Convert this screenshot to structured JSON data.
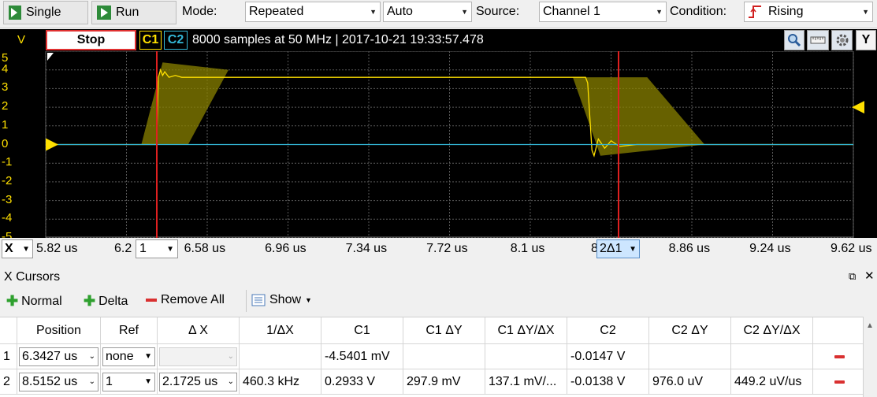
{
  "toolbar": {
    "single_label": "Single",
    "run_label": "Run",
    "mode_label": "Mode:",
    "mode_value": "Repeated",
    "auto_value": "Auto",
    "source_label": "Source:",
    "source_value": "Channel 1",
    "condition_label": "Condition:",
    "condition_value": "Rising"
  },
  "scope": {
    "y_unit": "V",
    "stop_label": "Stop",
    "c1_label": "C1",
    "c2_label": "C2",
    "status": "8000 samples at 50 MHz | 2017-10-21 19:33:57.478",
    "y_button": "Y",
    "x_button": "X",
    "colors": {
      "c1": "#ffe000",
      "c2": "#33b8d8",
      "cursor": "#e02020",
      "accent": "#ffe000"
    }
  },
  "chart_data": {
    "type": "line",
    "title": "",
    "xlabel": "",
    "ylabel": "V",
    "xlim": [
      5.82,
      9.62
    ],
    "ylim": [
      -5,
      5
    ],
    "y_ticks": [
      "5",
      "4",
      "3",
      "2",
      "1",
      "0",
      "-1",
      "-2",
      "-3",
      "-4",
      "-5"
    ],
    "x_ticks": [
      "5.82 us",
      "6.2",
      "6.58 us",
      "6.96 us",
      "7.34 us",
      "7.72 us",
      "8.1 us",
      "8",
      "8.86 us",
      "9.24 us",
      "9.62 us"
    ],
    "x_tick_values": [
      5.82,
      6.2,
      6.58,
      6.96,
      7.34,
      7.72,
      8.1,
      8.48,
      8.86,
      9.24,
      9.62
    ],
    "series": [
      {
        "x": [
          5.82,
          6.3,
          6.342,
          6.35,
          6.36,
          6.37,
          6.38,
          6.4,
          6.43,
          6.46,
          6.5,
          6.6,
          8.0,
          8.36,
          8.37,
          8.38,
          8.39,
          8.4,
          8.42,
          8.45,
          8.48,
          8.52,
          8.6,
          9.62
        ],
        "y": [
          0,
          0,
          0,
          3.6,
          4.0,
          3.7,
          3.9,
          3.6,
          3.7,
          3.6,
          3.6,
          3.6,
          3.6,
          3.6,
          3.3,
          1.5,
          -0.3,
          -0.6,
          0.3,
          -0.2,
          0.2,
          -0.1,
          0,
          0
        ]
      },
      {
        "x": [
          5.82,
          9.62
        ],
        "y": [
          0,
          0
        ]
      }
    ],
    "trigger_bands": [
      {
        "x": [
          6.27,
          6.37,
          6.68,
          6.49
        ],
        "y": [
          0,
          4.4,
          4.0,
          0
        ]
      },
      {
        "x": [
          8.3,
          8.65,
          8.92,
          8.43
        ],
        "y": [
          3.6,
          3.6,
          0,
          -0.6
        ]
      }
    ],
    "cursors_x": [
      6.3427,
      8.5152
    ]
  },
  "axis_x": {
    "ref_value": "1",
    "delta_label": "2Δ1"
  },
  "cursors": {
    "title": "X Cursors",
    "normal_label": "Normal",
    "delta_label": "Delta",
    "remove_all_label": "Remove All",
    "show_label": "Show",
    "columns": [
      "Position",
      "Ref",
      "Δ X",
      "1/ΔX",
      "C1",
      "C1 ΔY",
      "C1 ΔY/ΔX",
      "C2",
      "C2 ΔY",
      "C2 ΔY/ΔX"
    ],
    "rows": [
      {
        "index": "1",
        "position": "6.3427 us",
        "ref": "none",
        "dx": "",
        "inv_dx": "",
        "c1": "-4.5401 mV",
        "c1_dy": "",
        "c1_dydx": "",
        "c2": "-0.0147 V",
        "c2_dy": "",
        "c2_dydx": ""
      },
      {
        "index": "2",
        "position": "8.5152 us",
        "ref": "1",
        "dx": "2.1725 us",
        "inv_dx": "460.3 kHz",
        "c1": "0.2933 V",
        "c1_dy": "297.9 mV",
        "c1_dydx": "137.1 mV/...",
        "c2": "-0.0138 V",
        "c2_dy": "976.0 uV",
        "c2_dydx": "449.2 uV/us"
      }
    ]
  }
}
